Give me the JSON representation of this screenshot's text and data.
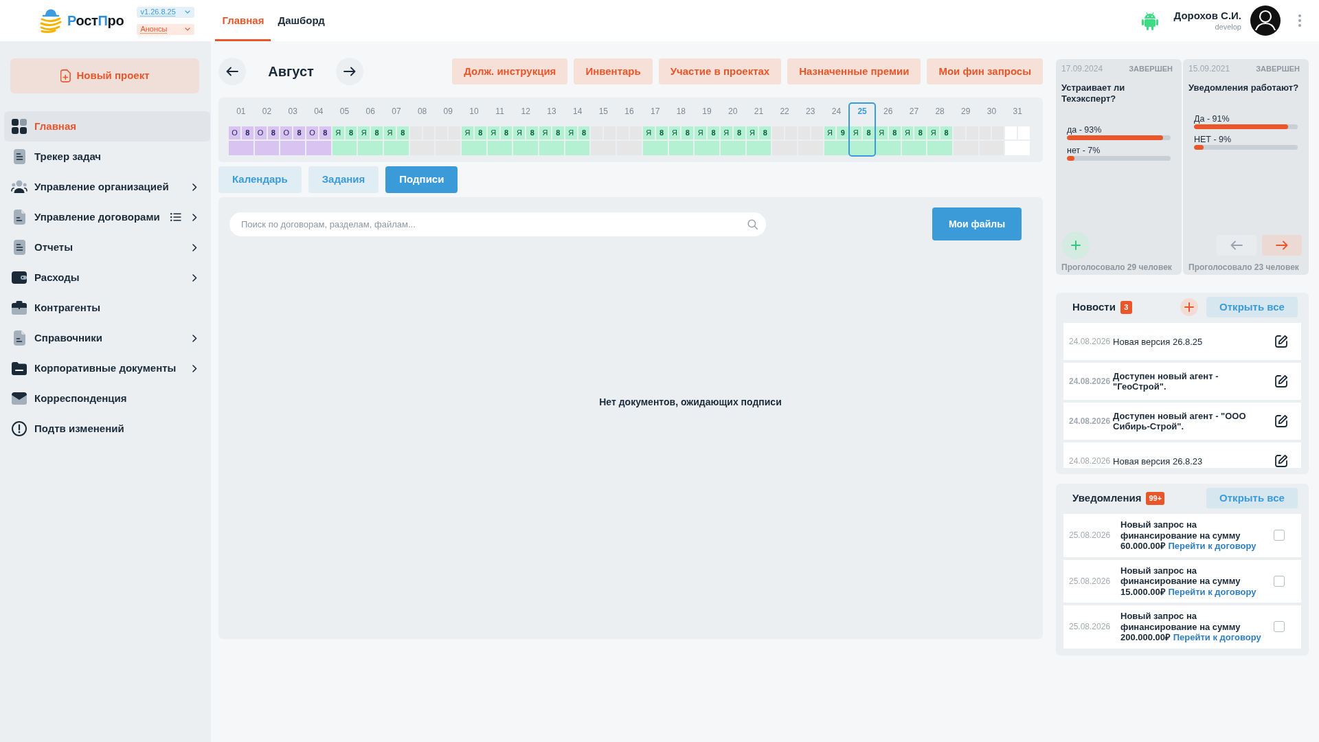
{
  "header": {
    "logo": [
      {
        "text": "Р",
        "accent": true
      },
      {
        "text": "ост",
        "accent": false
      },
      {
        "text": "П",
        "accent": true
      },
      {
        "text": "ро",
        "accent": false
      }
    ],
    "version": "v1.26.8.25",
    "announcements": "Анонсы",
    "tabs": [
      {
        "label": "Главная",
        "selected": true
      },
      {
        "label": "Дашборд",
        "selected": false
      }
    ],
    "user": {
      "name": "Дорохов С.И.",
      "role": "develop"
    }
  },
  "sidebar": {
    "new_project": "Новый проект",
    "items": [
      {
        "label": "Главная",
        "selected": true,
        "expandable": false,
        "list_icon": false
      },
      {
        "label": "Трекер задач",
        "selected": false,
        "expandable": false,
        "list_icon": false
      },
      {
        "label": "Управление организацией",
        "selected": false,
        "expandable": true,
        "list_icon": false
      },
      {
        "label": "Управление договорами",
        "selected": false,
        "expandable": true,
        "list_icon": true
      },
      {
        "label": "Отчеты",
        "selected": false,
        "expandable": true,
        "list_icon": false
      },
      {
        "label": "Расходы",
        "selected": false,
        "expandable": true,
        "list_icon": false
      },
      {
        "label": "Контрагенты",
        "selected": false,
        "expandable": false,
        "list_icon": false
      },
      {
        "label": "Справочники",
        "selected": false,
        "expandable": true,
        "list_icon": false
      },
      {
        "label": "Корпоративные документы",
        "selected": false,
        "expandable": true,
        "list_icon": false
      },
      {
        "label": "Корреспонденция",
        "selected": false,
        "expandable": false,
        "list_icon": false
      },
      {
        "label": "Подтв изменений",
        "selected": false,
        "expandable": false,
        "list_icon": false
      }
    ]
  },
  "month_nav": {
    "month": "Август"
  },
  "quick_buttons": [
    "Долж. инструкция",
    "Инвентарь",
    "Участие в проектах",
    "Назначенные премии",
    "Мои фин запросы"
  ],
  "calendar": {
    "days": [
      {
        "day": "01",
        "kind": "vacation",
        "code": "О",
        "hours": "8",
        "selected": false
      },
      {
        "day": "02",
        "kind": "vacation",
        "code": "О",
        "hours": "8",
        "selected": false
      },
      {
        "day": "03",
        "kind": "vacation",
        "code": "О",
        "hours": "8",
        "selected": false
      },
      {
        "day": "04",
        "kind": "vacation",
        "code": "О",
        "hours": "8",
        "selected": false
      },
      {
        "day": "05",
        "kind": "work",
        "code": "Я",
        "hours": "8",
        "selected": false
      },
      {
        "day": "06",
        "kind": "work",
        "code": "Я",
        "hours": "8",
        "selected": false
      },
      {
        "day": "07",
        "kind": "work",
        "code": "Я",
        "hours": "8",
        "selected": false
      },
      {
        "day": "08",
        "kind": "off",
        "selected": false
      },
      {
        "day": "09",
        "kind": "off",
        "selected": false
      },
      {
        "day": "10",
        "kind": "work",
        "code": "Я",
        "hours": "8",
        "selected": false
      },
      {
        "day": "11",
        "kind": "work",
        "code": "Я",
        "hours": "8",
        "selected": false
      },
      {
        "day": "12",
        "kind": "work",
        "code": "Я",
        "hours": "8",
        "selected": false
      },
      {
        "day": "13",
        "kind": "work",
        "code": "Я",
        "hours": "8",
        "selected": false
      },
      {
        "day": "14",
        "kind": "work",
        "code": "Я",
        "hours": "8",
        "selected": false
      },
      {
        "day": "15",
        "kind": "off",
        "selected": false
      },
      {
        "day": "16",
        "kind": "off",
        "selected": false
      },
      {
        "day": "17",
        "kind": "work",
        "code": "Я",
        "hours": "8",
        "selected": false
      },
      {
        "day": "18",
        "kind": "work",
        "code": "Я",
        "hours": "8",
        "selected": false
      },
      {
        "day": "19",
        "kind": "work",
        "code": "Я",
        "hours": "8",
        "selected": false
      },
      {
        "day": "20",
        "kind": "work",
        "code": "Я",
        "hours": "8",
        "selected": false
      },
      {
        "day": "21",
        "kind": "work",
        "code": "Я",
        "hours": "8",
        "selected": false
      },
      {
        "day": "22",
        "kind": "off",
        "selected": false
      },
      {
        "day": "23",
        "kind": "off",
        "selected": false
      },
      {
        "day": "24",
        "kind": "work",
        "code": "Я",
        "hours": "9",
        "selected": false
      },
      {
        "day": "25",
        "kind": "work",
        "code": "Я",
        "hours": "8",
        "selected": true
      },
      {
        "day": "26",
        "kind": "work",
        "code": "Я",
        "hours": "8",
        "selected": false
      },
      {
        "day": "27",
        "kind": "work",
        "code": "Я",
        "hours": "8",
        "selected": false
      },
      {
        "day": "28",
        "kind": "work",
        "code": "Я",
        "hours": "8",
        "selected": false
      },
      {
        "day": "29",
        "kind": "off",
        "selected": false
      },
      {
        "day": "30",
        "kind": "off",
        "selected": false
      },
      {
        "day": "31",
        "kind": "none",
        "selected": false
      }
    ]
  },
  "view_tabs": [
    {
      "label": "Календарь",
      "selected": false
    },
    {
      "label": "Задания",
      "selected": false
    },
    {
      "label": "Подписи",
      "selected": true
    }
  ],
  "signatures": {
    "search": {
      "placeholder": "Поиск по договорам, разделам, файлам..."
    },
    "files_button": "Мои файлы",
    "empty_message": "Нет документов, ожидающих подписи"
  },
  "polls": {
    "items": [
      {
        "date": "17.09.2024",
        "status": "ЗАВЕРШЕН",
        "question": "Устраивает ли Техэксперт?",
        "options": [
          {
            "label": "да - 93%",
            "level": 0.93
          },
          {
            "label": "нет - 7%",
            "level": 0.07
          }
        ],
        "votes": "Проголосовало 29 человек"
      },
      {
        "date": "15.09.2021",
        "status": "ЗАВЕРШЕН",
        "question": "Уведомления работают?",
        "options": [
          {
            "label": "Да - 91%",
            "level": 0.91
          },
          {
            "label": "НЕТ - 9%",
            "level": 0.09
          }
        ],
        "votes": "Проголосовало 23 человек"
      }
    ],
    "pager": {
      "prev_enabled": false,
      "next_enabled": true
    }
  },
  "news": {
    "title": "Новости",
    "count": "3",
    "open_all": "Открыть все",
    "items": [
      {
        "date": "24.08.2026",
        "text": "Новая версия 26.8.25",
        "unread": false
      },
      {
        "date": "24.08.2026",
        "text": "Доступен новый агент - \"ГеоСтрой\".",
        "unread": true
      },
      {
        "date": "24.08.2026",
        "text": "Доступен новый агент - \"ООО Сибирь-Строй\".",
        "unread": true
      },
      {
        "date": "24.08.2026",
        "text": "Новая версия 26.8.23",
        "unread": false
      }
    ]
  },
  "notifications": {
    "title": "Уведомления",
    "count": "99+",
    "open_all": "Открыть все",
    "items": [
      {
        "date": "25.08.2026",
        "text": "Новый запрос на финансирование на сумму 60.000.00₽",
        "link": "Перейти к договору",
        "checked": false
      },
      {
        "date": "25.08.2026",
        "text": "Новый запрос на финансирование на сумму 15.000.00₽",
        "link": "Перейти к договору",
        "checked": false
      },
      {
        "date": "25.08.2026",
        "text": "Новый запрос на финансирование на сумму 200.000.00₽",
        "link": "Перейти к договору",
        "checked": false
      }
    ]
  }
}
